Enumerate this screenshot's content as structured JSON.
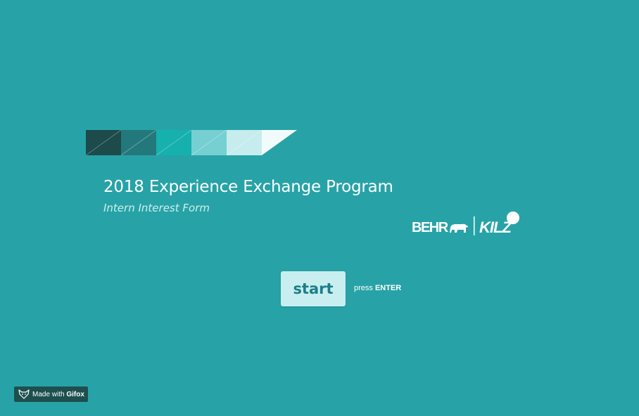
{
  "form": {
    "title": "2018 Experience Exchange Program",
    "subtitle": "Intern Interest Form"
  },
  "swatch_strip": {
    "colors": [
      "#1d4a4b",
      "#23787b",
      "#16b0ad",
      "#76cfd1",
      "#c6ecee",
      "#f2fbfb"
    ]
  },
  "logos": {
    "primary_logo": "BEHR",
    "secondary_logo": "KILZ"
  },
  "start": {
    "button_label": "start",
    "hint_prefix": "press",
    "hint_key": "ENTER"
  },
  "badge": {
    "text": "Made with",
    "brand": "Gifox",
    "icon": "fox-icon"
  },
  "theme": {
    "background": "#27a3a7",
    "button_background": "#c9eef0",
    "button_text": "#1b7f86",
    "badge_background": "#1d4f4f"
  }
}
